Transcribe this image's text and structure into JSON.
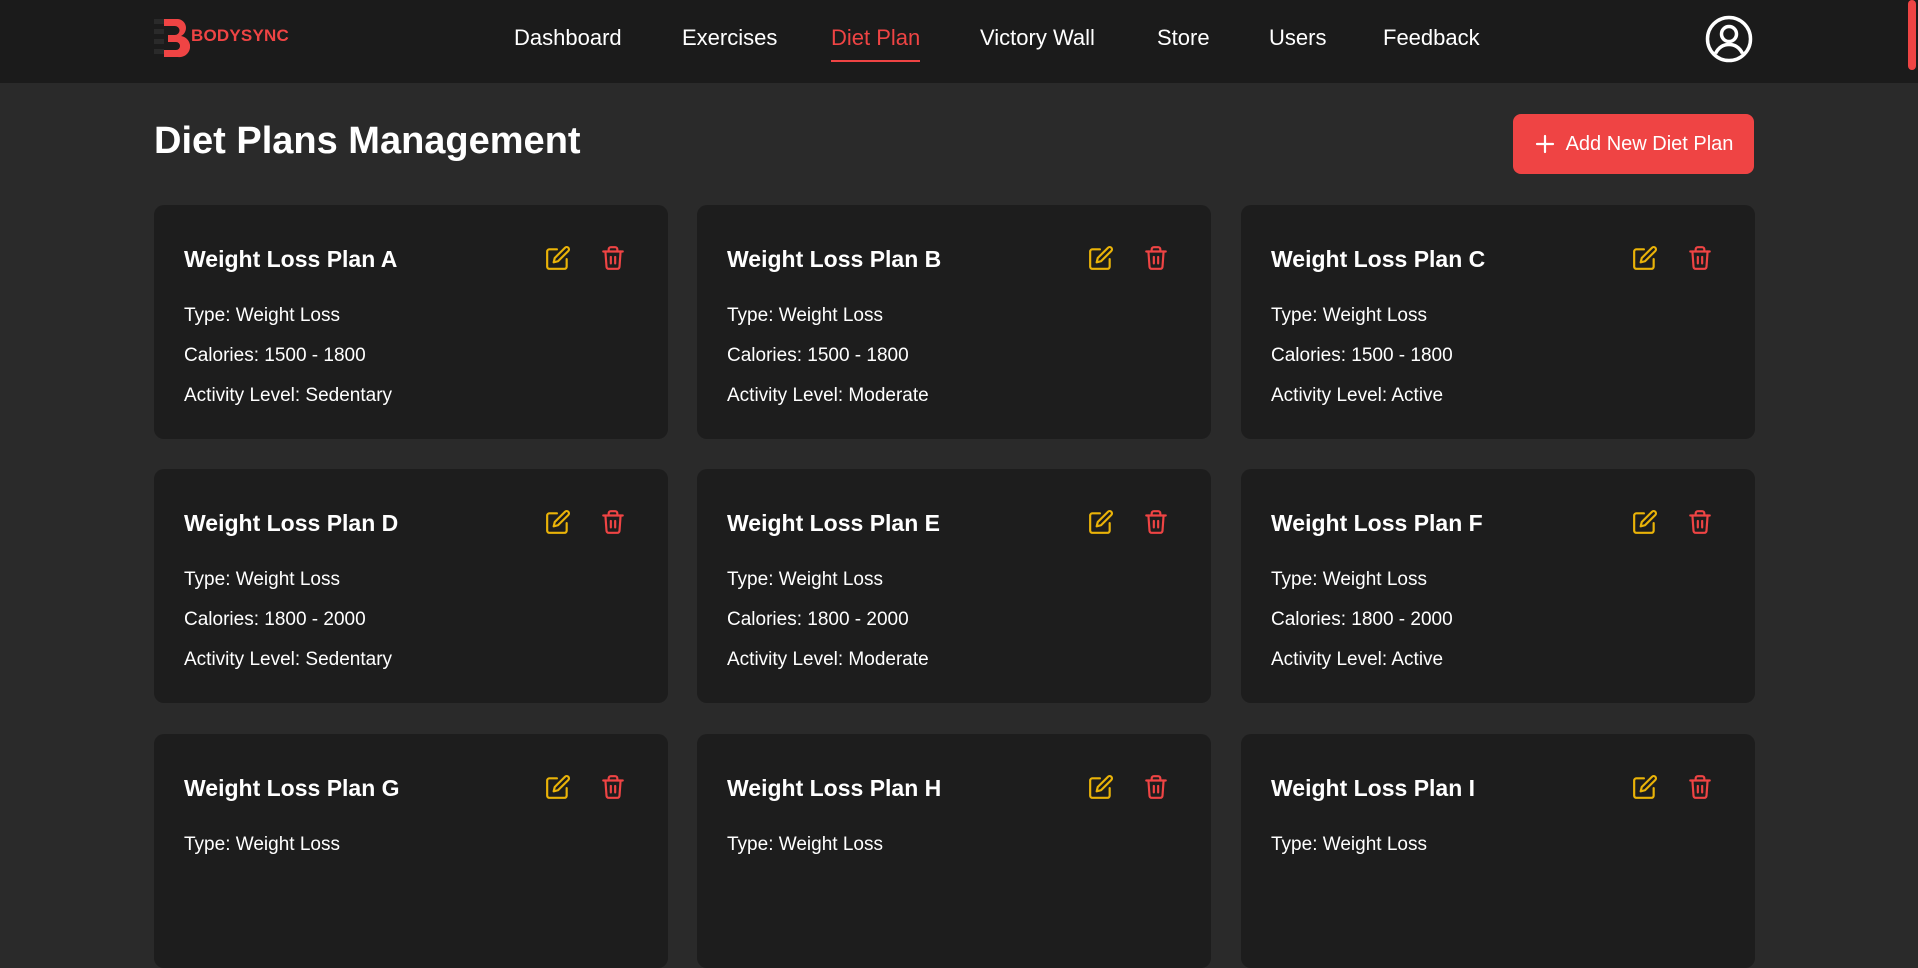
{
  "brand": {
    "name": "BODYSYNC"
  },
  "nav": {
    "items": [
      {
        "label": "Dashboard"
      },
      {
        "label": "Exercises"
      },
      {
        "label": "Diet Plan",
        "active": true
      },
      {
        "label": "Victory Wall"
      },
      {
        "label": "Store"
      },
      {
        "label": "Users"
      },
      {
        "label": "Feedback"
      }
    ]
  },
  "page": {
    "title": "Diet Plans Management",
    "add_button_label": "Add New Diet Plan"
  },
  "colors": {
    "accent": "#ef4444",
    "edit_icon": "#eab308",
    "card_bg": "#1d1d1d",
    "page_bg": "#2a2a2a",
    "nav_bg": "#1b1b1b"
  },
  "icons": {
    "edit": "edit-icon",
    "delete": "trash-icon",
    "profile": "user-circle-icon",
    "add": "plus-icon"
  },
  "cards": [
    {
      "title": "Weight Loss Plan A",
      "type": "Type: Weight Loss",
      "calories": "Calories: 1500 - 1800",
      "activity": "Activity Level: Sedentary"
    },
    {
      "title": "Weight Loss Plan B",
      "type": "Type: Weight Loss",
      "calories": "Calories: 1500 - 1800",
      "activity": "Activity Level: Moderate"
    },
    {
      "title": "Weight Loss Plan C",
      "type": "Type: Weight Loss",
      "calories": "Calories: 1500 - 1800",
      "activity": "Activity Level: Active"
    },
    {
      "title": "Weight Loss Plan D",
      "type": "Type: Weight Loss",
      "calories": "Calories: 1800 - 2000",
      "activity": "Activity Level: Sedentary"
    },
    {
      "title": "Weight Loss Plan E",
      "type": "Type: Weight Loss",
      "calories": "Calories: 1800 - 2000",
      "activity": "Activity Level: Moderate"
    },
    {
      "title": "Weight Loss Plan F",
      "type": "Type: Weight Loss",
      "calories": "Calories: 1800 - 2000",
      "activity": "Activity Level: Active"
    },
    {
      "title": "Weight Loss Plan G",
      "type": "Type: Weight Loss",
      "calories": "",
      "activity": ""
    },
    {
      "title": "Weight Loss Plan H",
      "type": "Type: Weight Loss",
      "calories": "",
      "activity": ""
    },
    {
      "title": "Weight Loss Plan I",
      "type": "Type: Weight Loss",
      "calories": "",
      "activity": ""
    }
  ]
}
